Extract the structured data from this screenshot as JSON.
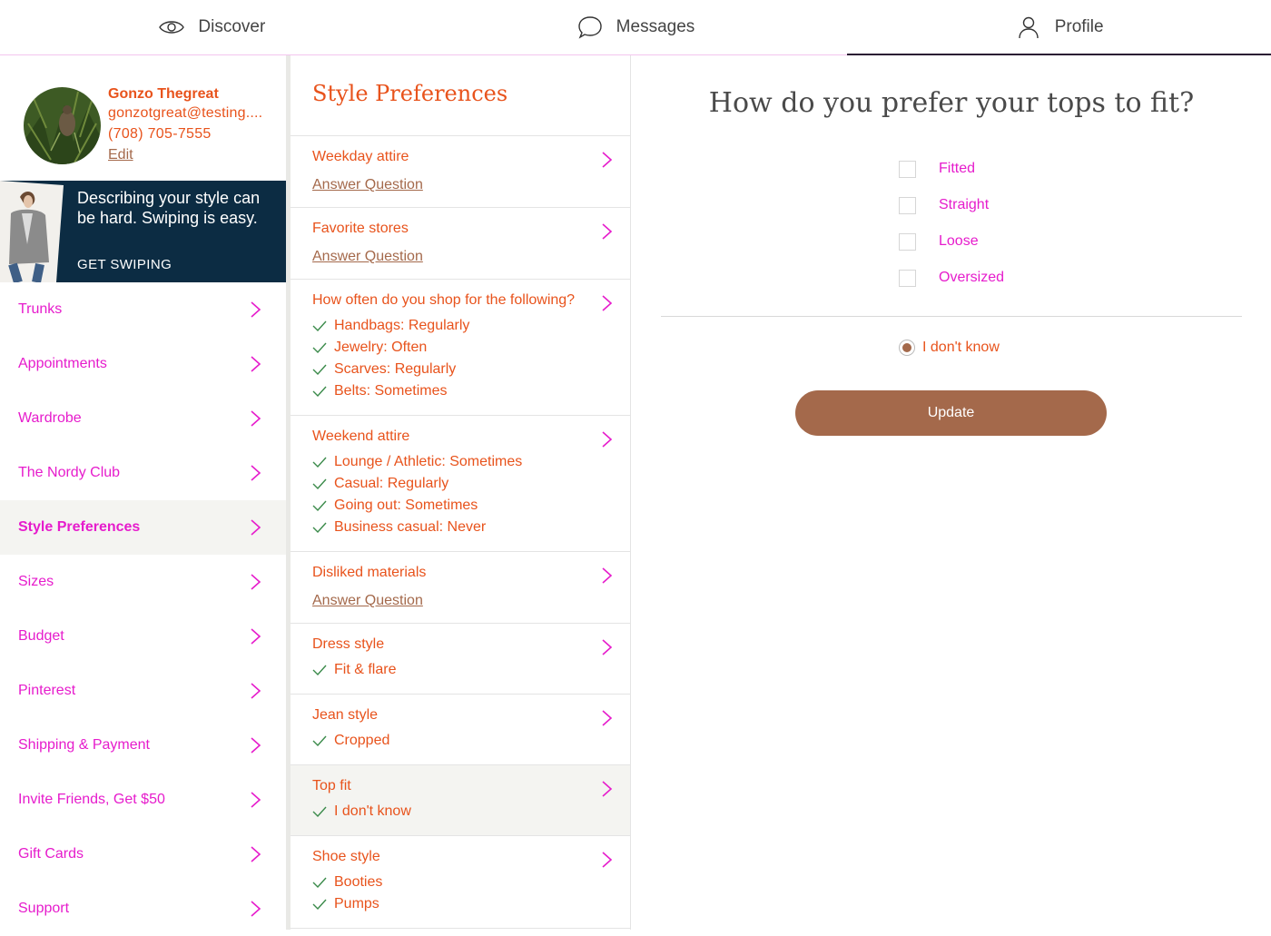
{
  "nav": {
    "tabs": [
      {
        "label": "Discover",
        "icon": "eye-icon"
      },
      {
        "label": "Messages",
        "icon": "chat-bubble-icon"
      },
      {
        "label": "Profile",
        "icon": "person-icon"
      }
    ],
    "active_tab": "Profile"
  },
  "profile": {
    "name": "Gonzo Thegreat",
    "email": "gonzotgreat@testing....",
    "phone": "(708) 705-7555",
    "edit_label": "Edit"
  },
  "promo": {
    "text": "Describing your style can be hard. Swiping is easy.",
    "cta": "GET SWIPING"
  },
  "sidebar": {
    "items": [
      {
        "label": "Trunks"
      },
      {
        "label": "Appointments"
      },
      {
        "label": "Wardrobe"
      },
      {
        "label": "The Nordy Club"
      },
      {
        "label": "Style Preferences"
      },
      {
        "label": "Sizes"
      },
      {
        "label": "Budget"
      },
      {
        "label": "Pinterest"
      },
      {
        "label": "Shipping & Payment"
      },
      {
        "label": "Invite Friends, Get $50"
      },
      {
        "label": "Gift Cards"
      },
      {
        "label": "Support"
      }
    ],
    "active_item": "Style Preferences"
  },
  "style_prefs": {
    "title": "Style Preferences",
    "questions": [
      {
        "title": "Weekday attire",
        "link": "Answer Question"
      },
      {
        "title": "Favorite stores",
        "link": "Answer Question"
      },
      {
        "title": "How often do you shop for the following?",
        "answers": [
          "Handbags: Regularly",
          "Jewelry: Often",
          "Scarves: Regularly",
          "Belts: Sometimes"
        ]
      },
      {
        "title": "Weekend attire",
        "answers": [
          "Lounge / Athletic: Sometimes",
          "Casual: Regularly",
          "Going out: Sometimes",
          "Business casual: Never"
        ]
      },
      {
        "title": "Disliked materials",
        "link": "Answer Question"
      },
      {
        "title": "Dress style",
        "answers": [
          "Fit & flare"
        ]
      },
      {
        "title": "Jean style",
        "answers": [
          "Cropped"
        ]
      },
      {
        "title": "Top fit",
        "answers": [
          "I don't know"
        ]
      },
      {
        "title": "Shoe style",
        "answers": [
          "Booties",
          "Pumps"
        ]
      }
    ]
  },
  "question_panel": {
    "title": "How do you prefer your tops to fit?",
    "options": [
      {
        "label": "Fitted",
        "checked": false
      },
      {
        "label": "Straight",
        "checked": false
      },
      {
        "label": "Loose",
        "checked": false
      },
      {
        "label": "Oversized",
        "checked": false
      }
    ],
    "dont_know_label": "I don't know",
    "dont_know_selected": true,
    "update_label": "Update"
  },
  "colors": {
    "orange": "#e8531c",
    "magenta": "#e61ccc",
    "brown": "#a4694b",
    "navy": "#0c2c43"
  }
}
